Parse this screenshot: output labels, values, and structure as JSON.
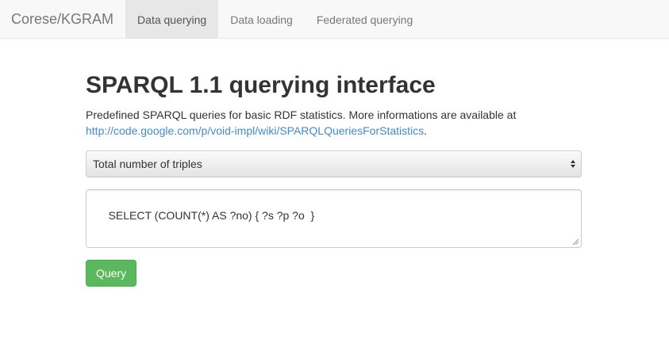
{
  "navbar": {
    "brand": "Corese/KGRAM",
    "items": [
      {
        "label": "Data querying",
        "active": true
      },
      {
        "label": "Data loading",
        "active": false
      },
      {
        "label": "Federated querying",
        "active": false
      }
    ]
  },
  "main": {
    "title": "SPARQL 1.1 querying interface",
    "description": "Predefined SPARQL queries for basic RDF statistics. More informations are available at",
    "link_text": "http://code.google.com/p/void-impl/wiki/SPARQLQueriesForStatistics",
    "link_suffix": ".",
    "select": {
      "selected": "Total number of triples"
    },
    "query_text": "SELECT (COUNT(*) AS ?no) { ?s ?p ?o  }",
    "query_button": "Query"
  },
  "colors": {
    "navbar_bg": "#f8f8f8",
    "link": "#428bca",
    "button_success": "#5cb85c"
  },
  "icons": [
    "select-arrows-icon",
    "resize-grip-icon"
  ]
}
